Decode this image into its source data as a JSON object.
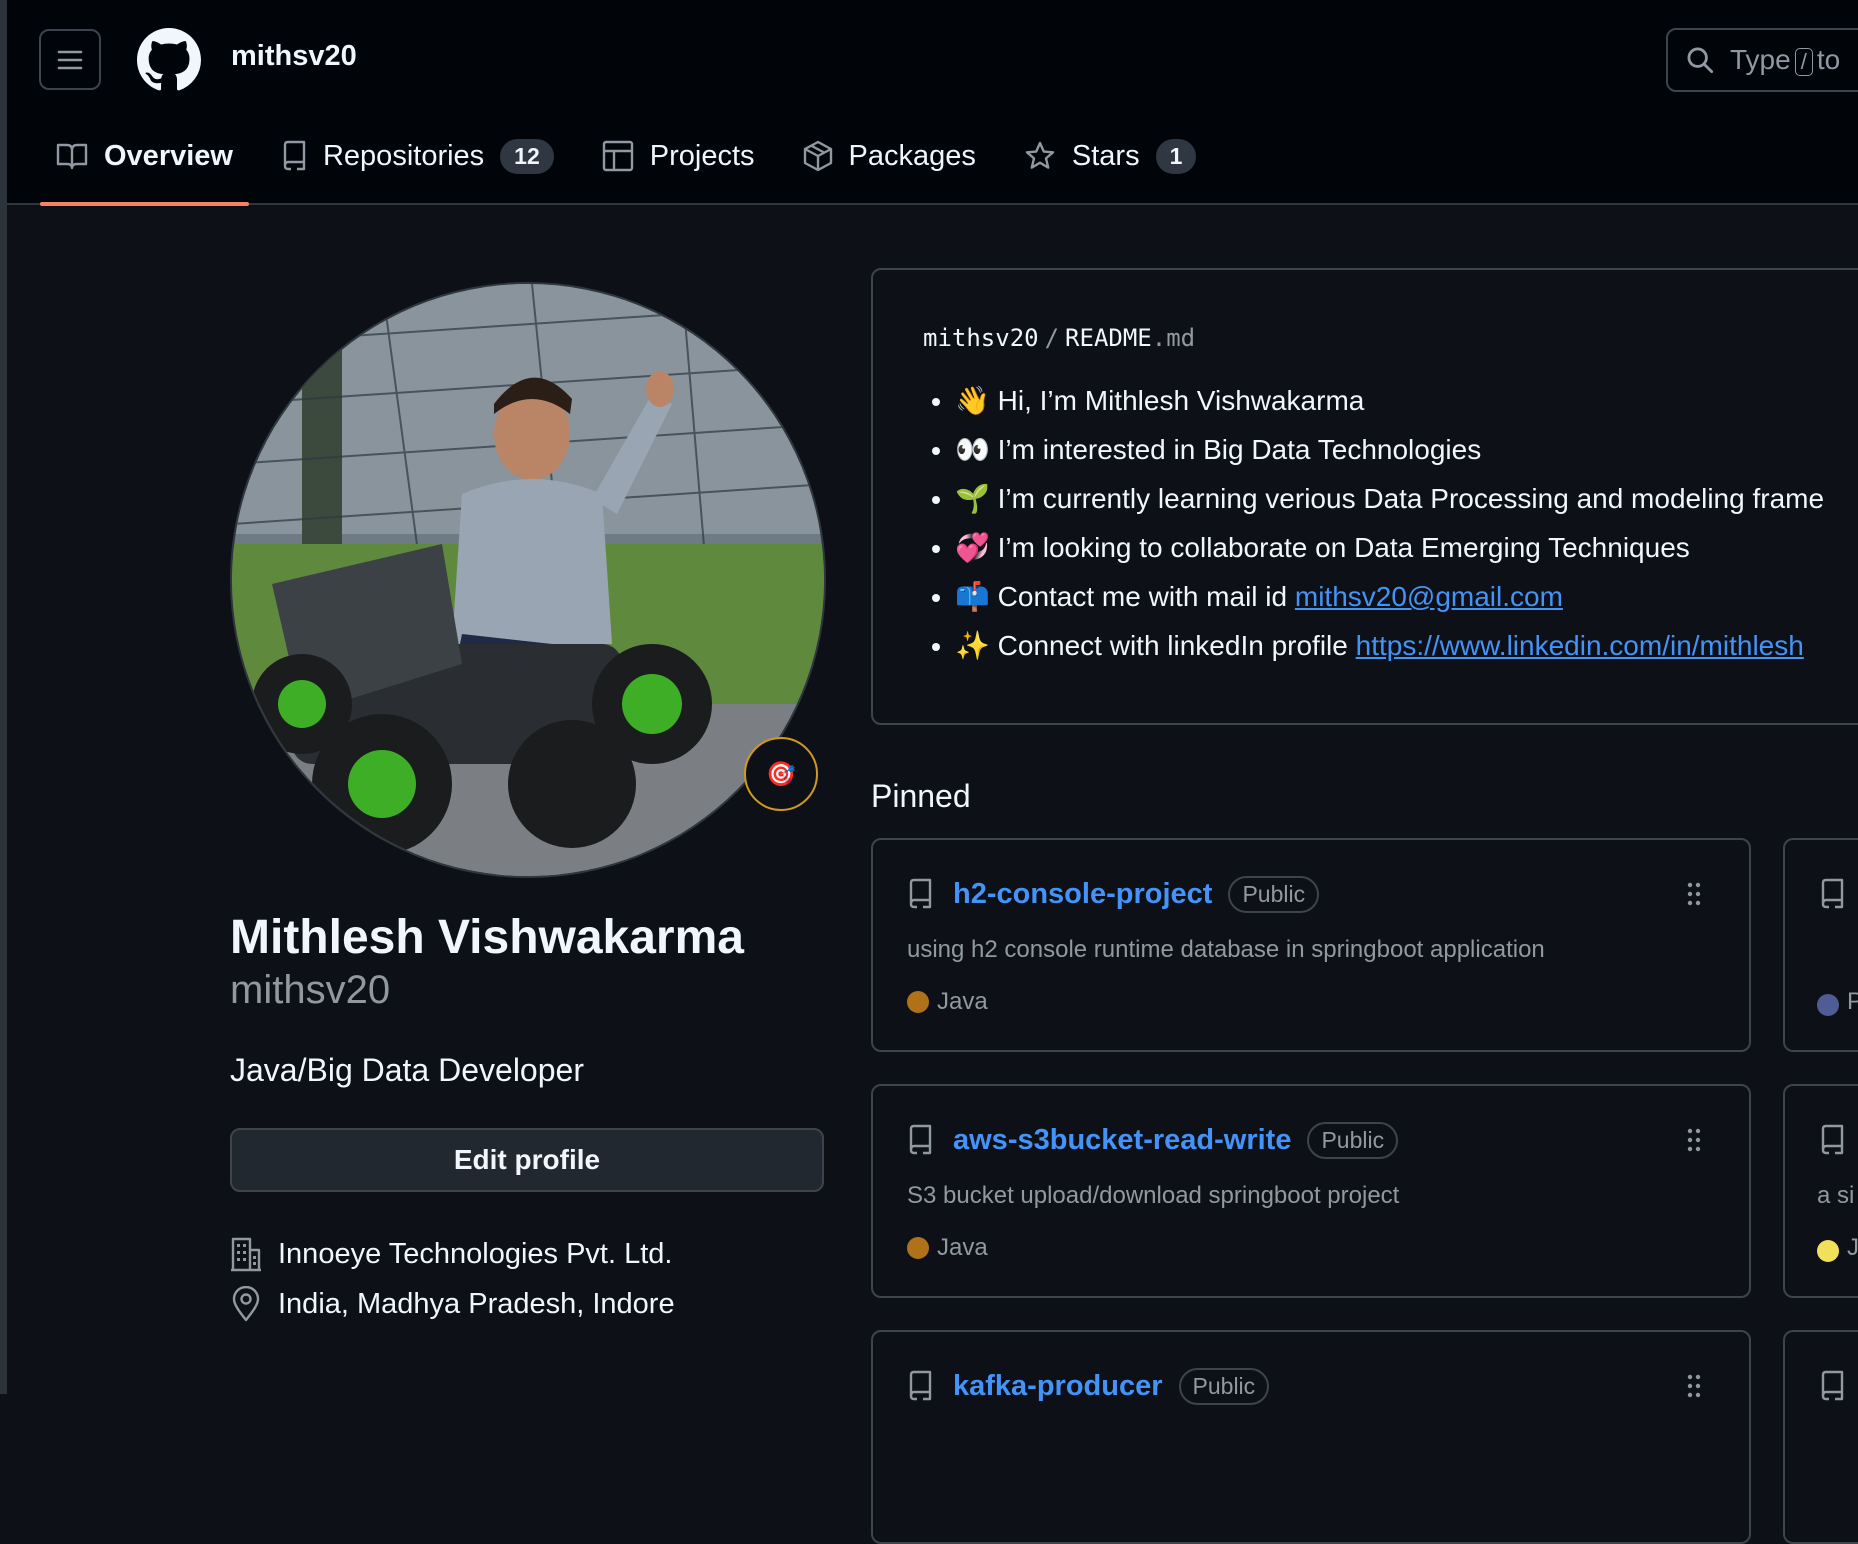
{
  "header": {
    "owner": "mithsv20",
    "search_prefix": "Type",
    "search_key": "/",
    "search_suffix": "to"
  },
  "tabs": [
    {
      "label": "Overview",
      "icon": "book-icon",
      "active": true
    },
    {
      "label": "Repositories",
      "icon": "repo-icon",
      "count": "12"
    },
    {
      "label": "Projects",
      "icon": "table-icon"
    },
    {
      "label": "Packages",
      "icon": "package-icon"
    },
    {
      "label": "Stars",
      "icon": "star-icon",
      "count": "1"
    }
  ],
  "profile": {
    "full_name": "Mithlesh Vishwakarma",
    "username": "mithsv20",
    "bio": "Java/Big Data Developer",
    "edit_label": "Edit profile",
    "company": "Innoeye Technologies Pvt. Ltd.",
    "location": "India, Madhya Pradesh, Indore",
    "status_emoji": "🎯"
  },
  "readme": {
    "path_owner": "mithsv20",
    "path_sep": "/",
    "path_file": "README",
    "path_ext": ".md",
    "items": [
      {
        "emoji": "👋",
        "text": "Hi, I’m Mithlesh Vishwakarma",
        "link": ""
      },
      {
        "emoji": "👀",
        "text": "I’m interested in Big Data Technologies",
        "link": ""
      },
      {
        "emoji": "🌱",
        "text": "I’m currently learning verious Data Processing and modeling frame",
        "link": ""
      },
      {
        "emoji": "💞️",
        "text": "I’m looking to collaborate on Data Emerging Techniques",
        "link": ""
      },
      {
        "emoji": "📫",
        "text": "Contact me with mail id ",
        "link": "mithsv20@gmail.com"
      },
      {
        "emoji": "✨",
        "text": "Connect with linkedIn profile ",
        "link": "https://www.linkedin.com/in/mithlesh"
      }
    ]
  },
  "pinned": {
    "title": "Pinned",
    "cards": [
      {
        "name": "h2-console-project",
        "visibility": "Public",
        "description": "using h2 console runtime database in springboot application",
        "language": "Java",
        "lang_color": "#b07219"
      },
      {
        "name": "aws-s3bucket-read-write",
        "visibility": "Public",
        "description": "S3 bucket upload/download springboot project",
        "language": "Java",
        "lang_color": "#b07219"
      },
      {
        "name": "kafka-producer",
        "visibility": "Public",
        "description": "",
        "language": "",
        "lang_color": ""
      }
    ],
    "right_cards": [
      {
        "description": "",
        "language_initial": "P",
        "lang_color": "#4F5D95"
      },
      {
        "description": "a si",
        "language_initial": "J",
        "lang_color": "#f1e05a"
      },
      {
        "description": "",
        "language_initial": "",
        "lang_color": ""
      }
    ]
  }
}
